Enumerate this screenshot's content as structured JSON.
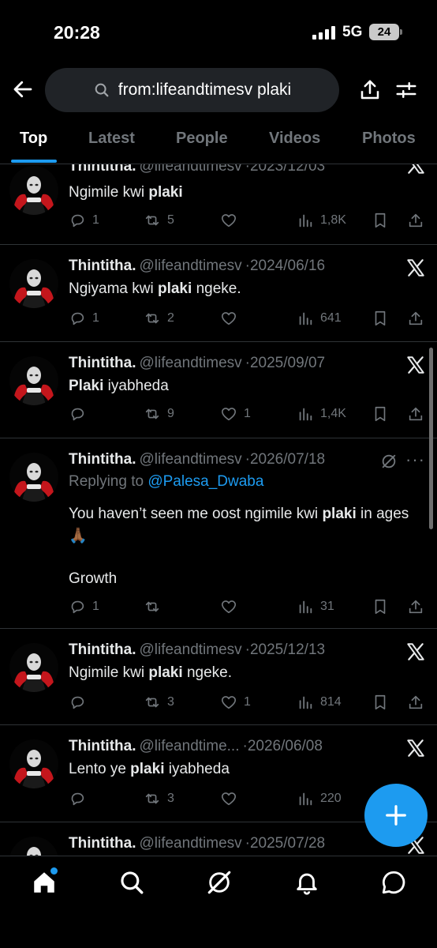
{
  "status": {
    "time": "20:28",
    "network": "5G",
    "battery": "24"
  },
  "search": {
    "query": "from:lifeandtimesv plaki"
  },
  "tabs": [
    "Top",
    "Latest",
    "People",
    "Videos",
    "Photos"
  ],
  "tweets": [
    {
      "name": "Thintitha.",
      "handle": "@lifeandtimesv",
      "date": "2023/12/03",
      "text_before": "Ngimile kwi ",
      "text_bold": "plaki",
      "text_after": "",
      "replies": "1",
      "reposts": "5",
      "likes": "",
      "views": "1,8K"
    },
    {
      "name": "Thintitha.",
      "handle": "@lifeandtimesv",
      "date": "2024/06/16",
      "text_before": "Ngiyama kwi ",
      "text_bold": "plaki",
      "text_after": " ngeke.",
      "replies": "1",
      "reposts": "2",
      "likes": "",
      "views": "641"
    },
    {
      "name": "Thintitha.",
      "handle": "@lifeandtimesv",
      "date": "2025/09/07",
      "text_before": "",
      "text_bold": "Plaki",
      "text_after": " iyabheda",
      "replies": "",
      "reposts": "9",
      "likes": "1",
      "views": "1,4K"
    },
    {
      "name": "Thintitha.",
      "handle": "@lifeandtimesv",
      "date": "2026/07/18",
      "replying_label": "Replying to",
      "replying_to": "@Palesa_Dwaba",
      "text_before": "You haven’t seen me oost ngimile kwi ",
      "text_bold": "plaki",
      "text_after": " in ages 🙏🏾",
      "text_extra": "Growth",
      "replies": "1",
      "reposts": "",
      "likes": "",
      "views": "31"
    },
    {
      "name": "Thintitha.",
      "handle": "@lifeandtimesv",
      "date": "2025/12/13",
      "text_before": "Ngimile kwi ",
      "text_bold": "plaki",
      "text_after": " ngeke.",
      "replies": "",
      "reposts": "3",
      "likes": "1",
      "views": "814"
    },
    {
      "name": "Thintitha.",
      "handle": "@lifeandtime...",
      "date": "2026/06/08",
      "text_before": "Lento ye ",
      "text_bold": "plaki",
      "text_after": " iyabheda",
      "replies": "",
      "reposts": "3",
      "likes": "",
      "views": "220"
    },
    {
      "name": "Thintitha.",
      "handle": "@lifeandtimesv",
      "date": "2025/07/28"
    }
  ],
  "separator": "·",
  "more_label": "···",
  "colors": {
    "accent": "#1d9bf0",
    "muted": "#71767b",
    "background": "#000000"
  }
}
